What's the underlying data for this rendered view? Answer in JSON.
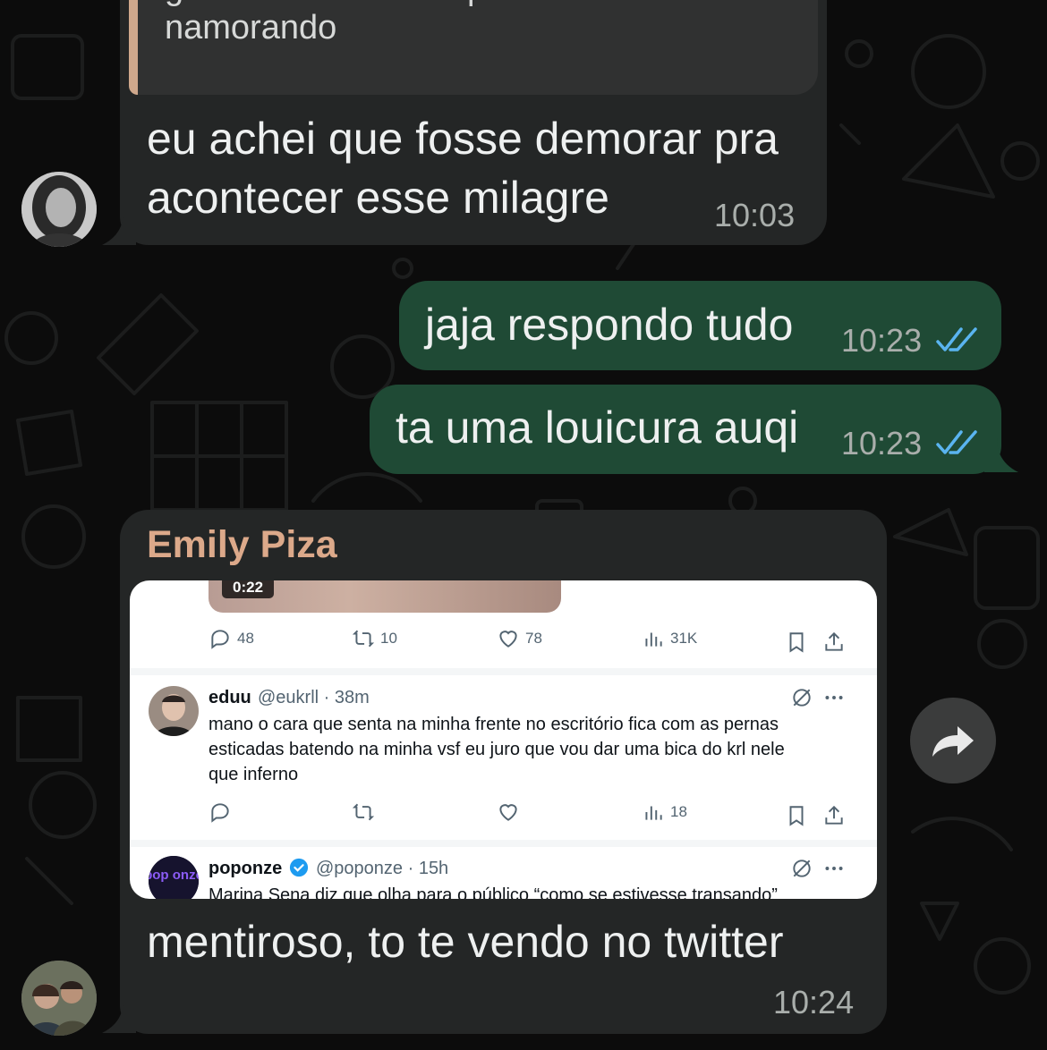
{
  "chat": {
    "messages": [
      {
        "quote": {
          "line1": "gente não acredito que o eduardo está",
          "line2": "namorando"
        },
        "text_line1": "eu achei que fosse demorar pra",
        "text_line2": "acontecer esse milagre",
        "time": "10:03"
      },
      {
        "text": "jaja respondo tudo",
        "time": "10:23"
      },
      {
        "text": "ta uma louicura auqi",
        "time": "10:23"
      },
      {
        "sender": "Emily Piza",
        "text": "mentiroso, to te vendo no twitter",
        "time": "10:24"
      }
    ],
    "tweet_screenshot": {
      "video_duration": "0:22",
      "top_stats": {
        "replies": "48",
        "retweets": "10",
        "likes": "78",
        "views": "31K"
      },
      "tweet1": {
        "name": "eduu",
        "meta": "@eukrll · 38m",
        "body_line1": "mano o cara que senta na minha frente no escritório fica com as pernas",
        "body_line2": "esticadas batendo na minha vsf eu juro que vou dar uma bica do krl nele",
        "body_line3": "que inferno",
        "views": "18"
      },
      "tweet2": {
        "name": "poponze",
        "meta": "@poponze · 15h",
        "body_partial": "Marina Sena diz que olha para o público “como se estivesse transando”",
        "avatar_text": "pop onze"
      }
    },
    "colors": {
      "background": "#0c0c0c",
      "incoming_bubble": "#242626",
      "outgoing_bubble": "#1f4a35",
      "sender_name": "#dca98a",
      "read_ticks": "#5ab4f0"
    }
  }
}
